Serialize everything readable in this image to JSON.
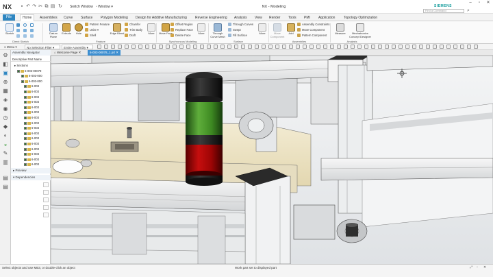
{
  "titlebar": {
    "logo": "NX",
    "switch_window": "Switch Window",
    "window_menu": "Window",
    "title": "NX - Modeling",
    "brand": "SIEMENS",
    "search_placeholder": "Find a Command"
  },
  "ribbon_tabs": [
    "Home",
    "Assemblies",
    "Curve",
    "Surface",
    "Polygon Modeling",
    "Design for Additive Manufacturing",
    "Reverse Engineering",
    "Analysis",
    "View",
    "Render",
    "Tools",
    "PMI",
    "Application",
    "Topology Optimization"
  ],
  "file_tab": "File",
  "ribbon": {
    "sketch": "Sketch",
    "direct_sketch": "Direct Sketch",
    "datum_plane": "Datum Plane",
    "extrude": "Extrude",
    "hole": "Hole",
    "pattern_feature": "Pattern Feature",
    "unite": "Unite",
    "shell": "Shell",
    "edge_blend": "Edge Blend",
    "chamfer": "Chamfer",
    "trim_body": "Trim Body",
    "draft": "Draft",
    "more1": "More",
    "feature": "Feature",
    "move_face": "Move Face",
    "offset_region": "Offset Region",
    "replace_face": "Replace Face",
    "delete_face": "Delete Face",
    "more2": "More",
    "synchronous_modeling": "Synchronous Modeling",
    "through_curve_mesh": "Through Curve Mesh",
    "through_curves": "Through Curves",
    "swept": "Swept",
    "fill_surface": "Fill Surface",
    "more3": "More",
    "surface": "Surface",
    "move_component": "Move Component",
    "add": "Add",
    "assembly_constraints": "Assembly Constraints",
    "move_component2": "Move Component",
    "pattern_component": "Pattern Component",
    "assemblies": "Assemblies",
    "measure": "Measure",
    "mechatronics": "Mechatronics Concept Designer",
    "analysis": "Analysis"
  },
  "cmdbar": {
    "menu": "Menu",
    "selection_filter": "No Selection Filter",
    "scope": "Entire Assembly"
  },
  "doc_tabs": [
    "Welcome Page",
    "6-003-00078_1.prt"
  ],
  "navigator": {
    "title": "Assembly Navigator",
    "column_header": "Descriptive Part Name",
    "rows": [
      "Sections",
      "6-003-00079",
      "6-003-000",
      "6-003-000",
      "6-003",
      "6-003",
      "6-003",
      "6-003",
      "6-003",
      "6-003",
      "6-003",
      "6-003",
      "6-003",
      "6-003",
      "6-003",
      "6-003",
      "6-003",
      "6-003",
      "6-003",
      "6-003"
    ],
    "preview": "Preview",
    "dependencies": "Dependencies"
  },
  "status": {
    "left": "Select objects and use MB3, or double-click an object",
    "middle": "Work part set to displayed part"
  }
}
